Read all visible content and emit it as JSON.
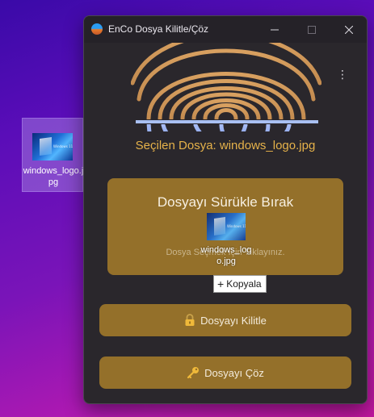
{
  "desktop": {
    "icon_label": "windows_logo.jpg"
  },
  "window": {
    "title": "EnCo Dosya Kilitle/Çöz",
    "menu_icon": "more-vertical-icon",
    "selected_file_text": "Seçilen Dosya: windows_logo.jpg",
    "drop_zone": {
      "title": "Dosyayı Sürükle Bırak",
      "hint": "Dosya Seçmek İçin Tıklayınız."
    },
    "lock_button": {
      "label": "Dosyayı Kilitle",
      "icon": "lock-icon"
    },
    "unlock_button": {
      "label": "Dosyayı Çöz",
      "icon": "key-icon"
    }
  },
  "drag": {
    "file_label": "windows_logo.jpg",
    "tooltip": "Kopyala"
  },
  "colors": {
    "accent": "#94702a",
    "selected_text": "#e6b24a",
    "window_bg": "#2a272c",
    "fingerprint_top": "#d49a55",
    "fingerprint_bottom": "#8aa8f0"
  }
}
